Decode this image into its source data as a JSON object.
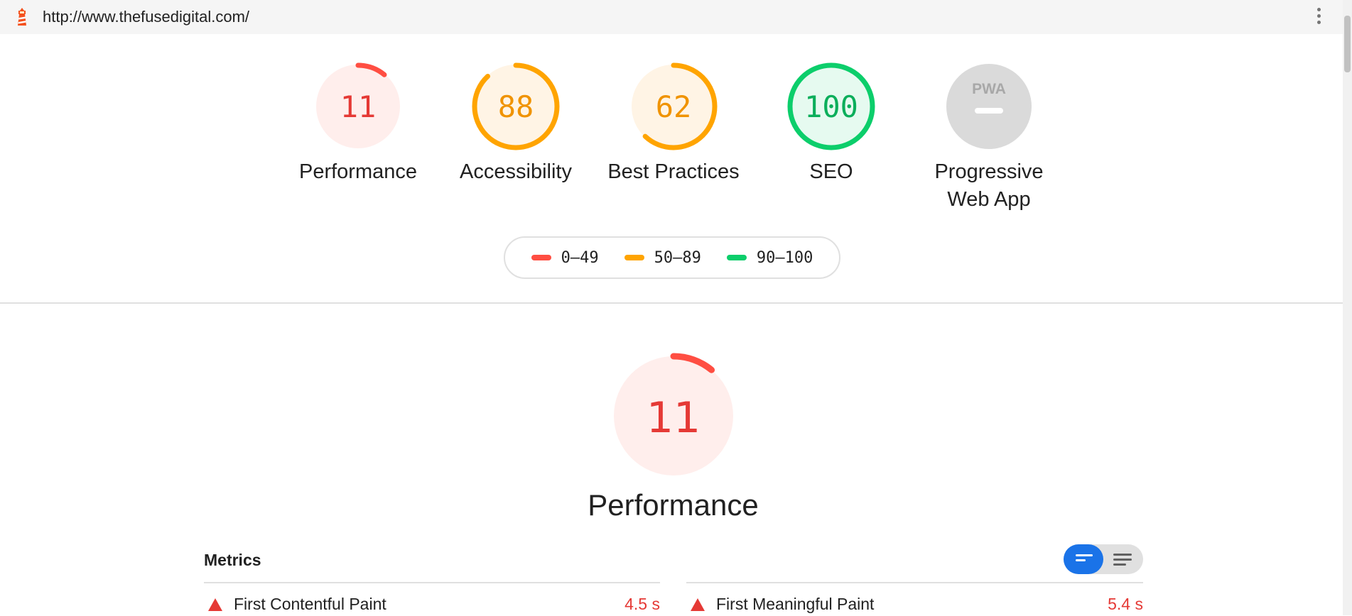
{
  "browser": {
    "url": "http://www.thefusedigital.com/",
    "logo_icon": "lighthouse-icon",
    "menu_icon": "more-vert-icon"
  },
  "colors": {
    "fail": "#ff4e42",
    "average": "#ffa400",
    "pass": "#0cce6b",
    "na": "#c8c8c8"
  },
  "gauges": [
    {
      "score": "11",
      "score_fraction": 0.11,
      "label": "Performance",
      "rating": "fail"
    },
    {
      "score": "88",
      "score_fraction": 0.88,
      "label": "Accessibility",
      "rating": "average"
    },
    {
      "score": "62",
      "score_fraction": 0.62,
      "label": "Best Practices",
      "rating": "average"
    },
    {
      "score": "100",
      "score_fraction": 1.0,
      "label": "SEO",
      "rating": "pass"
    },
    {
      "score": "",
      "label": "Progressive Web App",
      "label_line1": "Progressive",
      "label_line2": "Web App",
      "rating": "na",
      "badge": "PWA"
    }
  ],
  "legend": [
    {
      "range": "0–49",
      "rating": "fail"
    },
    {
      "range": "50–89",
      "rating": "average"
    },
    {
      "range": "90–100",
      "rating": "pass"
    }
  ],
  "performance": {
    "score": "11",
    "score_fraction": 0.11,
    "title": "Performance",
    "metrics_title": "Metrics",
    "view_toggle": {
      "selected": "compact-view",
      "icons": [
        "compact-view-icon",
        "expanded-view-icon"
      ]
    },
    "metrics": [
      {
        "name": "First Contentful Paint",
        "value": "4.5 s",
        "rating": "fail"
      },
      {
        "name": "First Meaningful Paint",
        "value": "5.4 s",
        "rating": "fail"
      }
    ]
  }
}
